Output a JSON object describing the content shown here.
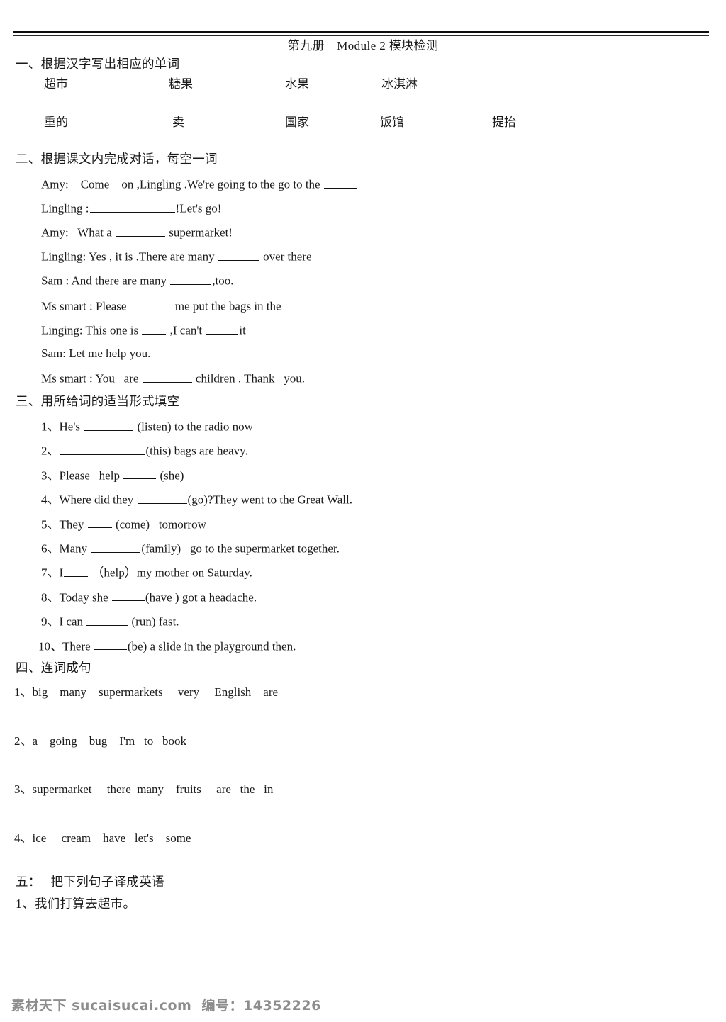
{
  "document": {
    "title": "第九册　Module 2 模块检测",
    "background_color": "#ffffff",
    "text_color": "#1a1a1a"
  },
  "section1": {
    "heading": "一、根据汉字写出相应的单词",
    "row1": [
      "超市",
      "糖果",
      "水果",
      "冰淇淋"
    ],
    "row2": [
      "重的",
      "卖",
      "国家",
      "饭馆",
      "提抬"
    ]
  },
  "section2": {
    "heading": "二、根据课文内完成对话，每空一词",
    "lines": {
      "l1_a": "Amy:    Come    on ,Lingling .We're going to the go to the ",
      "l2_a": "Lingling :",
      "l2_b": "!Let's go!",
      "l3_a": "Amy:   What a ",
      "l3_b": " supermarket!",
      "l4_a": "Lingling: Yes , it is .There are many ",
      "l4_b": " over there",
      "l5_a": "Sam : And there are many ",
      "l5_b": ",too.",
      "l6_a": "Ms smart : Please ",
      "l6_b": " me put the bags in the ",
      "l7_a": "Linging: This one is ",
      "l7_b": " ,I can't ",
      "l7_c": "it",
      "l8_a": "Sam: Let me help you.",
      "l9_a": "Ms smart : You   are ",
      "l9_b": " children . Thank   you."
    }
  },
  "section3": {
    "heading": "三、用所给词的适当形式填空",
    "items": [
      {
        "num": "1、",
        "before": "He's ",
        "after": " (listen) to the radio now",
        "blank": "b-l"
      },
      {
        "num": "2、",
        "before": "",
        "after": "(this) bags are heavy.",
        "blank": "b-xl"
      },
      {
        "num": "3、",
        "before": "Please   help ",
        "after": " (she)",
        "blank": "b-s"
      },
      {
        "num": "4、",
        "before": "Where did they ",
        "after": "(go)?They went to the Great Wall.",
        "blank": "b-l"
      },
      {
        "num": "5、",
        "before": "They ",
        "after": " (come)   tomorrow",
        "blank": "b-xs"
      },
      {
        "num": "6、",
        "before": "Many ",
        "after": "(family)   go to the supermarket together.",
        "blank": "b-l"
      },
      {
        "num": "7、",
        "before": "I",
        "after": " （help）my mother on Saturday.",
        "blank": "b-xs"
      },
      {
        "num": "8、",
        "before": "Today she ",
        "after": "(have ) got a headache.",
        "blank": "b-s"
      },
      {
        "num": "9、",
        "before": "I can ",
        "after": " (run) fast.",
        "blank": "b-m"
      },
      {
        "num": "10、",
        "before": "There ",
        "after": "(be) a slide in the playground then.",
        "blank": "b-s"
      }
    ]
  },
  "section4": {
    "heading": "四、连词成句",
    "items": [
      "1、big    many    supermarkets     very     English    are",
      "2、a    going    bug    I'm   to   book",
      "3、supermarket     there  many    fruits     are   the   in",
      "4、ice     cream    have   let's    some"
    ]
  },
  "section5": {
    "heading": "五：   把下列句子译成英语",
    "items": [
      "1、我们打算去超市。"
    ]
  },
  "footer": {
    "text": "素材天下 sucaisucai.com  编号：14352226"
  }
}
